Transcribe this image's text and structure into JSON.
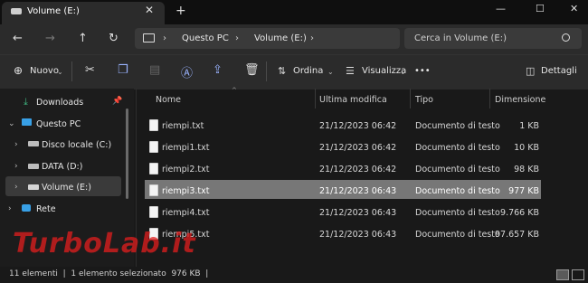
{
  "window": {
    "tab_title": "Volume (E:)",
    "tab_close": "✕",
    "new_tab": "+",
    "min": "—",
    "max": "☐",
    "close": "✕"
  },
  "nav": {
    "back": "←",
    "forward": "→",
    "up": "↑",
    "refresh": "↻"
  },
  "breadcrumb": {
    "items": [
      "Questo PC",
      "Volume (E:)"
    ]
  },
  "search": {
    "placeholder": "Cerca in Volume (E:)"
  },
  "toolbar": {
    "new_label": "Nuovo",
    "sort_label": "Ordina",
    "view_label": "Visualizza",
    "more": "•••",
    "details_label": "Dettagli"
  },
  "sidebar": {
    "downloads": "Downloads",
    "this_pc": "Questo PC",
    "drives": [
      "Disco locale (C:)",
      "DATA (D:)",
      "Volume (E:)"
    ],
    "network": "Rete"
  },
  "columns": {
    "name": "Nome",
    "modified": "Ultima modifica",
    "type": "Tipo",
    "size": "Dimensione"
  },
  "files": [
    {
      "name": "riempi.txt",
      "modified": "21/12/2023 06:42",
      "type": "Documento di testo",
      "size": "1 KB"
    },
    {
      "name": "riempi1.txt",
      "modified": "21/12/2023 06:42",
      "type": "Documento di testo",
      "size": "10 KB"
    },
    {
      "name": "riempi2.txt",
      "modified": "21/12/2023 06:42",
      "type": "Documento di testo",
      "size": "98 KB"
    },
    {
      "name": "riempi3.txt",
      "modified": "21/12/2023 06:43",
      "type": "Documento di testo",
      "size": "977 KB"
    },
    {
      "name": "riempi4.txt",
      "modified": "21/12/2023 06:43",
      "type": "Documento di testo",
      "size": "9.766 KB"
    },
    {
      "name": "riempi5.txt",
      "modified": "21/12/2023 06:43",
      "type": "Documento di testo",
      "size": "97.657 KB"
    }
  ],
  "status": {
    "text": "11 elementi  |  1 elemento selezionato  976 KB  |"
  },
  "watermark": {
    "text": "TurboLab.it"
  }
}
